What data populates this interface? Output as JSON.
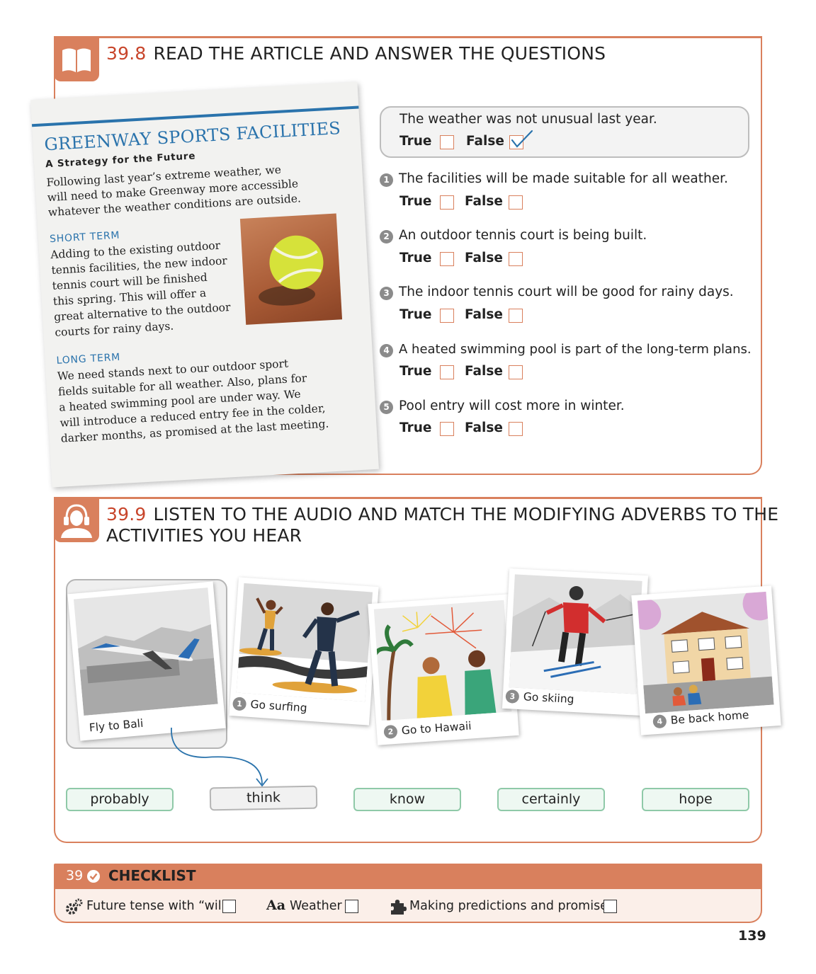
{
  "section1": {
    "number": "39.8",
    "title": "READ THE ARTICLE AND ANSWER THE QUESTIONS",
    "icon": "open-book-icon"
  },
  "article": {
    "title": "GREENWAY SPORTS FACILITIES",
    "subtitle": "A Strategy for the Future",
    "intro": [
      "Following last year’s extreme weather, we",
      "will need to make Greenway more accessible",
      "whatever the weather conditions are outside."
    ],
    "short_term_heading": "SHORT TERM",
    "short_term_lines": [
      "Adding to the existing outdoor",
      "tennis facilities, the new indoor",
      "tennis court will be finished",
      "this spring. This will offer a",
      "great alternative to the outdoor",
      "courts for rainy days."
    ],
    "long_term_heading": "LONG TERM",
    "long_term_lines": [
      "We need stands next to our outdoor sport",
      "fields suitable for all weather. Also, plans for",
      "a heated swimming pool are under way. We",
      "will introduce a reduced entry fee in the colder,",
      "darker months, as promised at the last meeting."
    ],
    "image": "tennis-ball-on-clay-court"
  },
  "questions": {
    "true_label": "True",
    "false_label": "False",
    "example": {
      "text": "The weather was not unusual last year.",
      "answer": "False"
    },
    "items": [
      {
        "num": "1",
        "text": "The facilities will be made suitable for all weather."
      },
      {
        "num": "2",
        "text": "An outdoor tennis court is being built."
      },
      {
        "num": "3",
        "text": "The indoor tennis court will be good for rainy days."
      },
      {
        "num": "4",
        "text": "A heated swimming pool is part of the long-term plans."
      },
      {
        "num": "5",
        "text": "Pool entry will cost more in winter."
      }
    ]
  },
  "section2": {
    "number": "39.9",
    "title_line1": "LISTEN TO THE AUDIO AND MATCH THE MODIFYING ADVERBS TO THE",
    "title_line2": "ACTIVITIES YOU HEAR",
    "icon": "headphones-person-icon"
  },
  "activities": [
    {
      "num": "",
      "label": "Fly to Bali"
    },
    {
      "num": "1",
      "label": "Go surfing"
    },
    {
      "num": "2",
      "label": "Go to Hawaii"
    },
    {
      "num": "3",
      "label": "Go skiing"
    },
    {
      "num": "4",
      "label": "Be back home"
    }
  ],
  "adverbs": [
    "probably",
    "think",
    "know",
    "certainly",
    "hope"
  ],
  "checklist": {
    "number": "39",
    "title": "CHECKLIST",
    "items": [
      {
        "icon": "gears-icon",
        "label": "Future tense with “will”"
      },
      {
        "icon": "Aa",
        "label": "Weather"
      },
      {
        "icon": "puzzle-icon",
        "label": "Making predictions and promises"
      }
    ]
  },
  "page_number": "139",
  "colors": {
    "accent": "#d9805d",
    "number_red": "#c8452b",
    "article_blue": "#2a73ac",
    "pill_green": "#8fc9a8"
  }
}
